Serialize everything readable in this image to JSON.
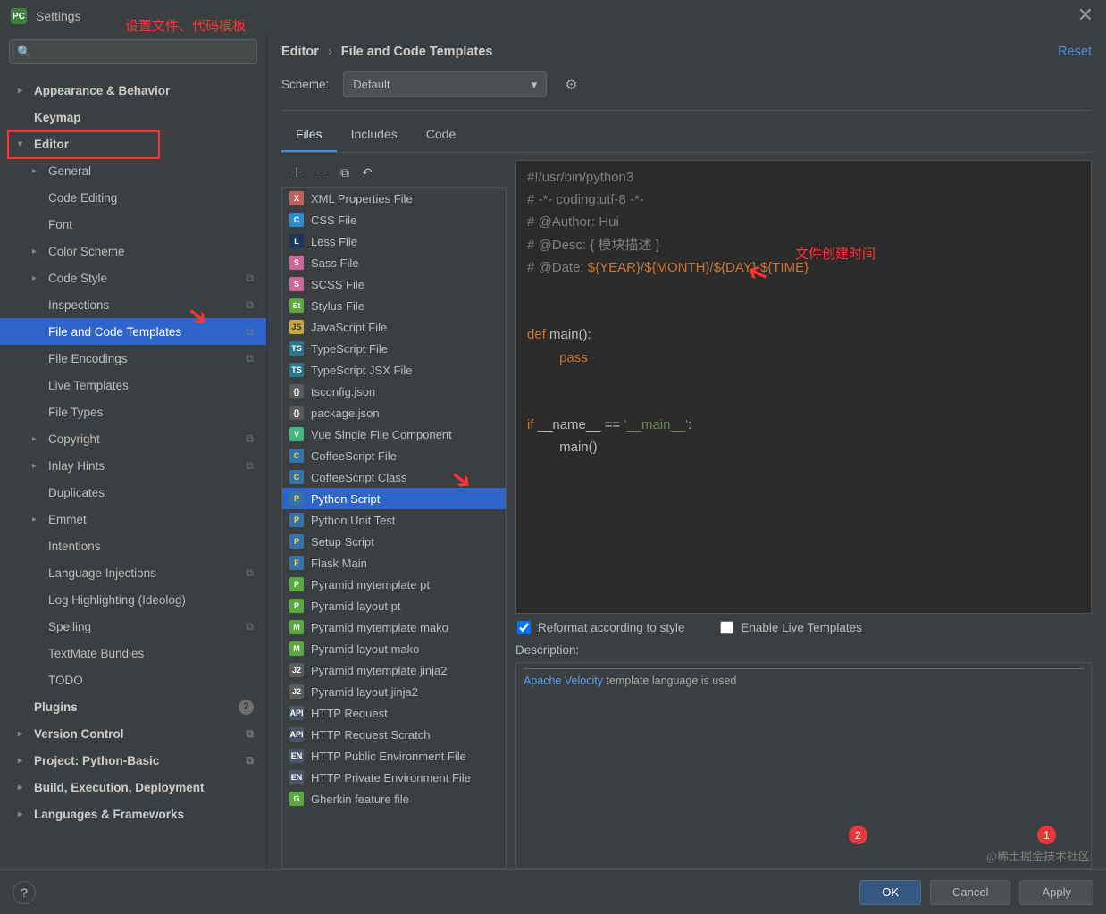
{
  "window": {
    "title": "Settings",
    "close": "✕"
  },
  "annotations": {
    "hint1": "设置文件、代码模板",
    "timeHint": "文件创建时间",
    "badge1": "1",
    "badge2": "2"
  },
  "breadcrumb": {
    "p1": "Editor",
    "p2": "File and Code Templates",
    "reset": "Reset"
  },
  "scheme": {
    "label": "Scheme:",
    "value": "Default"
  },
  "tabs": {
    "files": "Files",
    "includes": "Includes",
    "code": "Code"
  },
  "sidebar": [
    {
      "label": "Appearance & Behavior",
      "chev": "col",
      "bold": true,
      "lvl": 0
    },
    {
      "label": "Keymap",
      "bold": true,
      "lvl": 0,
      "nochev": true
    },
    {
      "label": "Editor",
      "chev": "exp",
      "bold": true,
      "lvl": 0
    },
    {
      "label": "General",
      "chev": "col",
      "lvl": 1
    },
    {
      "label": "Code Editing",
      "lvl": 1,
      "nochev": true
    },
    {
      "label": "Font",
      "lvl": 1,
      "nochev": true
    },
    {
      "label": "Color Scheme",
      "chev": "col",
      "lvl": 1
    },
    {
      "label": "Code Style",
      "chev": "col",
      "lvl": 1,
      "copy": true
    },
    {
      "label": "Inspections",
      "lvl": 1,
      "nochev": true,
      "copy": true
    },
    {
      "label": "File and Code Templates",
      "lvl": 1,
      "nochev": true,
      "sel": true,
      "copy": true
    },
    {
      "label": "File Encodings",
      "lvl": 1,
      "nochev": true,
      "copy": true
    },
    {
      "label": "Live Templates",
      "lvl": 1,
      "nochev": true
    },
    {
      "label": "File Types",
      "lvl": 1,
      "nochev": true
    },
    {
      "label": "Copyright",
      "chev": "col",
      "lvl": 1,
      "copy": true
    },
    {
      "label": "Inlay Hints",
      "chev": "col",
      "lvl": 1,
      "copy": true
    },
    {
      "label": "Duplicates",
      "lvl": 1,
      "nochev": true
    },
    {
      "label": "Emmet",
      "chev": "col",
      "lvl": 1
    },
    {
      "label": "Intentions",
      "lvl": 1,
      "nochev": true
    },
    {
      "label": "Language Injections",
      "lvl": 1,
      "nochev": true,
      "copy": true
    },
    {
      "label": "Log Highlighting (Ideolog)",
      "lvl": 1,
      "nochev": true
    },
    {
      "label": "Spelling",
      "lvl": 1,
      "nochev": true,
      "copy": true
    },
    {
      "label": "TextMate Bundles",
      "lvl": 1,
      "nochev": true
    },
    {
      "label": "TODO",
      "lvl": 1,
      "nochev": true
    },
    {
      "label": "Plugins",
      "bold": true,
      "lvl": 0,
      "nochev": true,
      "count": "2"
    },
    {
      "label": "Version Control",
      "chev": "col",
      "bold": true,
      "lvl": 0,
      "copy": true
    },
    {
      "label": "Project: Python-Basic",
      "chev": "col",
      "bold": true,
      "lvl": 0,
      "copy": true
    },
    {
      "label": "Build, Execution, Deployment",
      "chev": "col",
      "bold": true,
      "lvl": 0
    },
    {
      "label": "Languages & Frameworks",
      "chev": "col",
      "bold": true,
      "lvl": 0
    }
  ],
  "templates": [
    {
      "label": "XML Properties File",
      "cls": "fi-xml",
      "t": "X"
    },
    {
      "label": "CSS File",
      "cls": "fi-css",
      "t": "C"
    },
    {
      "label": "Less File",
      "cls": "fi-less",
      "t": "L"
    },
    {
      "label": "Sass File",
      "cls": "fi-sass",
      "t": "S"
    },
    {
      "label": "SCSS File",
      "cls": "fi-scss",
      "t": "S"
    },
    {
      "label": "Stylus File",
      "cls": "fi-styl",
      "t": "St"
    },
    {
      "label": "JavaScript File",
      "cls": "fi-js",
      "t": "JS"
    },
    {
      "label": "TypeScript File",
      "cls": "fi-ts",
      "t": "TS"
    },
    {
      "label": "TypeScript JSX File",
      "cls": "fi-ts",
      "t": "TS"
    },
    {
      "label": "tsconfig.json",
      "cls": "fi-json",
      "t": "{}"
    },
    {
      "label": "package.json",
      "cls": "fi-json",
      "t": "{}"
    },
    {
      "label": "Vue Single File Component",
      "cls": "fi-vue",
      "t": "V"
    },
    {
      "label": "CoffeeScript File",
      "cls": "fi-py",
      "t": "C"
    },
    {
      "label": "CoffeeScript Class",
      "cls": "fi-py",
      "t": "C"
    },
    {
      "label": "Python Script",
      "cls": "fi-py",
      "t": "P",
      "sel": true
    },
    {
      "label": "Python Unit Test",
      "cls": "fi-py",
      "t": "P"
    },
    {
      "label": "Setup Script",
      "cls": "fi-py",
      "t": "P"
    },
    {
      "label": "Flask Main",
      "cls": "fi-py",
      "t": "F"
    },
    {
      "label": "Pyramid mytemplate pt",
      "cls": "fi-sc",
      "t": "P"
    },
    {
      "label": "Pyramid layout pt",
      "cls": "fi-sc",
      "t": "P"
    },
    {
      "label": "Pyramid mytemplate mako",
      "cls": "fi-sc",
      "t": "M"
    },
    {
      "label": "Pyramid layout mako",
      "cls": "fi-sc",
      "t": "M"
    },
    {
      "label": "Pyramid mytemplate jinja2",
      "cls": "fi-j2",
      "t": "J2"
    },
    {
      "label": "Pyramid layout jinja2",
      "cls": "fi-j2",
      "t": "J2"
    },
    {
      "label": "HTTP Request",
      "cls": "fi-http",
      "t": "API"
    },
    {
      "label": "HTTP Request Scratch",
      "cls": "fi-http",
      "t": "API"
    },
    {
      "label": "HTTP Public Environment File",
      "cls": "fi-http",
      "t": "EN"
    },
    {
      "label": "HTTP Private Environment File",
      "cls": "fi-http",
      "t": "EN"
    },
    {
      "label": "Gherkin feature file",
      "cls": "fi-gh",
      "t": "G"
    }
  ],
  "code": {
    "l1": "#!/usr/bin/python3",
    "l2": "# -*- coding:utf-8 -*-",
    "l3": "# @Author: Hui",
    "l4a": "# @Desc: { ",
    "l4b": "模块描述",
    "l4c": " }",
    "l5a": "# @Date: ",
    "l5b": "${YEAR}",
    "l5c": "/",
    "l5d": "${MONTH}",
    "l5e": "/",
    "l5f": "${DAY}",
    "l5g": " ",
    "l5h": "${TIME}",
    "l6a": "def ",
    "l6b": "main():",
    "l7": "pass",
    "l8a": "if ",
    "l8b": "__name__ == ",
    "l8c": "'__main__'",
    "l8d": ":",
    "l9": "main()"
  },
  "options": {
    "reformat": "Reformat according to style",
    "live": "Enable Live Templates"
  },
  "descLabel": "Description:",
  "desc": {
    "link": "Apache Velocity",
    "text": " template language is used"
  },
  "footer": {
    "ok": "OK",
    "cancel": "Cancel",
    "apply": "Apply"
  },
  "watermark": "@稀土掘金技术社区"
}
